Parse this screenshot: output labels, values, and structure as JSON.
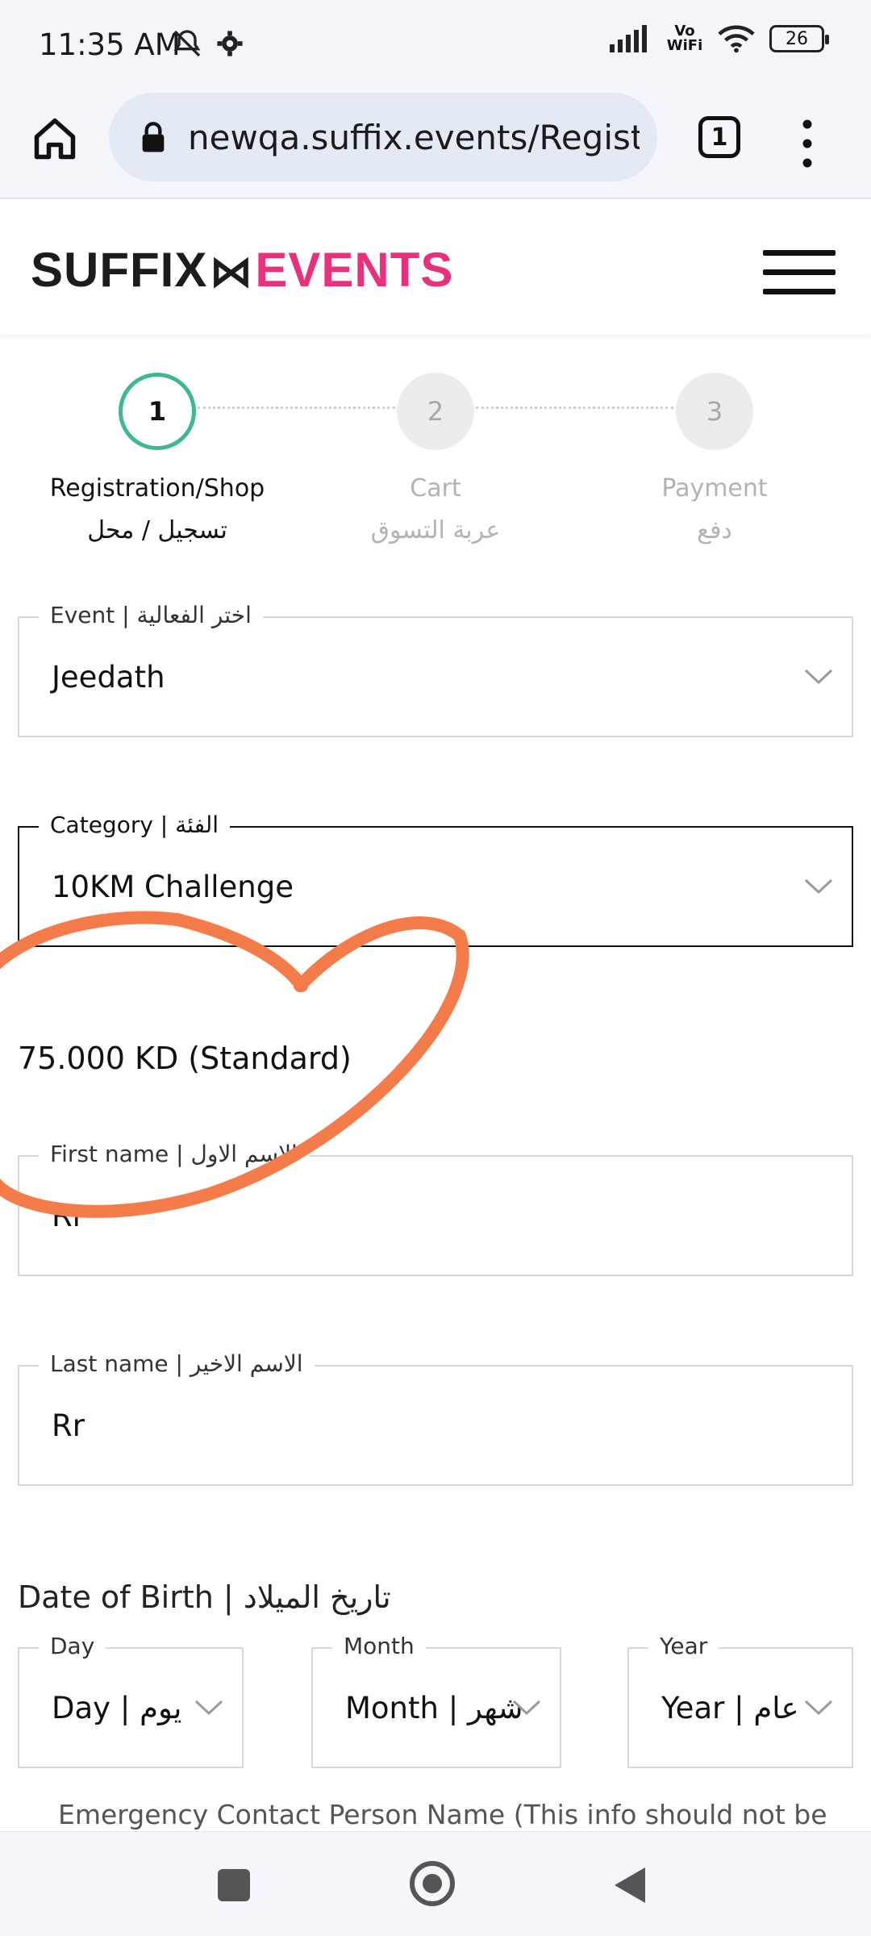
{
  "status_bar": {
    "time": "11:35 AM",
    "network": "Vo WiFi",
    "battery": "26"
  },
  "browser": {
    "url": "newqa.suffix.events/Registra",
    "tab_count": "1"
  },
  "site": {
    "logo_left": "SUFFIX",
    "logo_right": "EVENTS"
  },
  "stepper": [
    {
      "number": "1",
      "label_en": "Registration/Shop",
      "label_ar": "تسجيل / محل",
      "state": "active"
    },
    {
      "number": "2",
      "label_en": "Cart",
      "label_ar": "عربة التسوق",
      "state": "inactive"
    },
    {
      "number": "3",
      "label_en": "Payment",
      "label_ar": "دفع",
      "state": "inactive"
    }
  ],
  "form": {
    "event": {
      "label": "Event | اختر الفعالية",
      "value": "Jeedath"
    },
    "category": {
      "label": "Category | الفئة",
      "value": "10KM Challenge"
    },
    "price": "75.000 KD (Standard)",
    "first_name": {
      "label": "First name | الاسم الاول",
      "value": "Rr"
    },
    "last_name": {
      "label": "Last name | الاسم الاخير",
      "value": "Rr"
    },
    "dob_title": "Date of Birth | تاريخ الميلاد",
    "day": {
      "label": "Day",
      "value": "Day | يوم"
    },
    "month": {
      "label": "Month",
      "value": "Month | شهر"
    },
    "year": {
      "label": "Year",
      "value": "Year | عام"
    },
    "emergency_label": "Emergency Contact Person Name (This info should not be"
  },
  "colors": {
    "accent_green": "#3fb88f",
    "brand_pink": "#e8317d",
    "annotation_orange": "#f47c4a"
  }
}
